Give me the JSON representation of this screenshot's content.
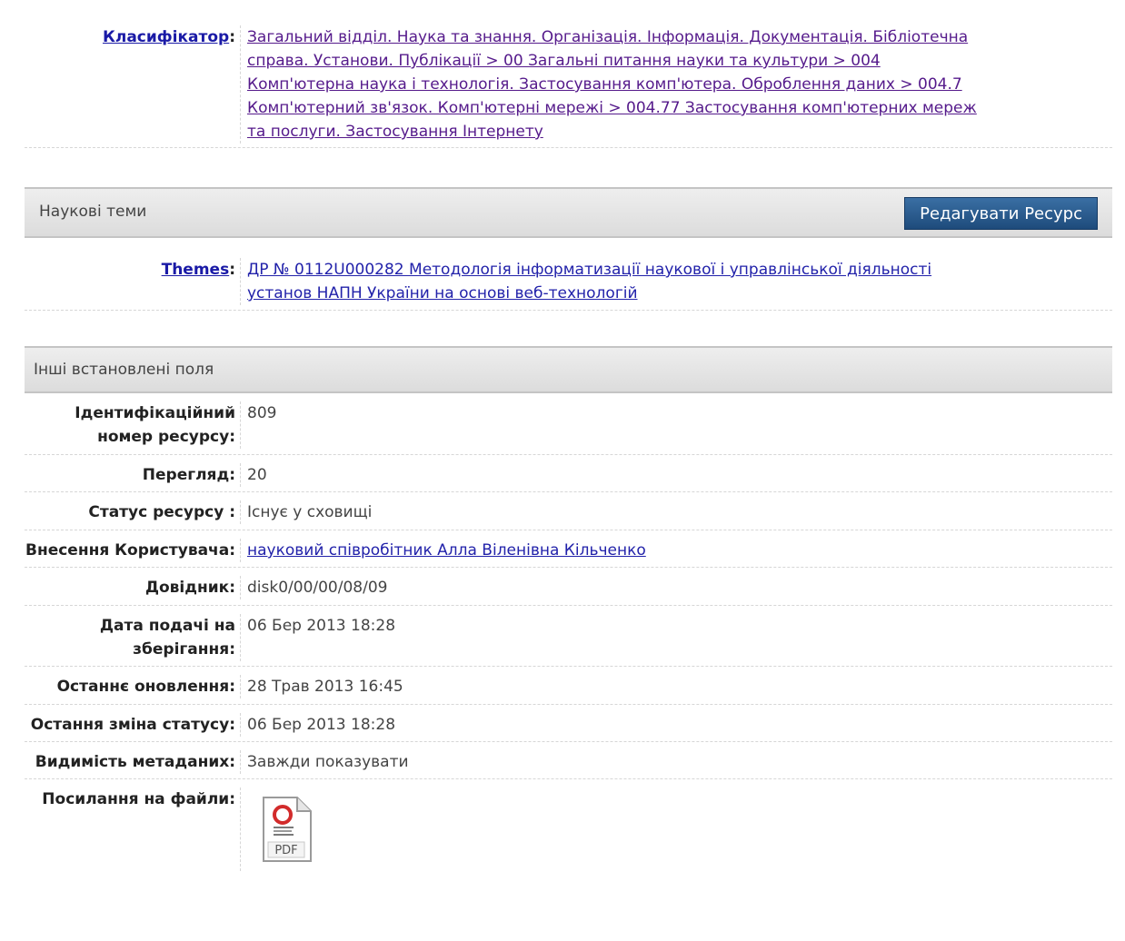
{
  "classifier": {
    "label": "Класифікатор",
    "colon": ":",
    "lines": [
      "Загальний відділ. Наука та знання. Організація. Інформація. Документація. Бібліотечна",
      "справа. Установи. Публікації > 00 Загальні питання науки та культури > 004",
      "Комп'ютерна наука і технологія. Застосування комп'ютера. Оброблення даних > 004.7",
      "Комп'ютерний зв'язок. Комп'ютерні мережі > 004.77 Застосування комп'ютерних мереж",
      "та послуги. Застосування Інтернету"
    ]
  },
  "science_section": {
    "title": "Наукові теми",
    "edit_button": "Редагувати Ресурс"
  },
  "themes": {
    "label": "Themes",
    "colon": ":",
    "lines": [
      "ДР № 0112U000282 Методологія інформатизації наукової і управлінської діяльності",
      "установ НАПН України на основі веб-технологій"
    ]
  },
  "other_section": {
    "title": "Інші встановлені поля"
  },
  "fields": {
    "id_label": "Ідентифікаційний номер ресурсу:",
    "id_value": "809",
    "views_label": "Перегляд:",
    "views_value": "20",
    "status_label": "Статус ресурсу :",
    "status_value": "Існує у сховищі",
    "deposit_label": "Внесення Користувача:",
    "deposit_value": "науковий співробітник Алла Віленівна Кільченко",
    "directory_label": "Довідник:",
    "directory_value": "disk0/00/00/08/09",
    "date_label": "Дата подачі на зберігання:",
    "date_value": "06 Бер 2013 18:28",
    "updated_label": "Останнє оновлення:",
    "updated_value": "28 Трав 2013 16:45",
    "status_change_label": "Остання зміна статусу:",
    "status_change_value": "06 Бер 2013 18:28",
    "visibility_label": "Видимість метаданих:",
    "visibility_value": "Завжди показувати",
    "files_label": "Посилання на файли:",
    "pdf_text": "PDF"
  }
}
